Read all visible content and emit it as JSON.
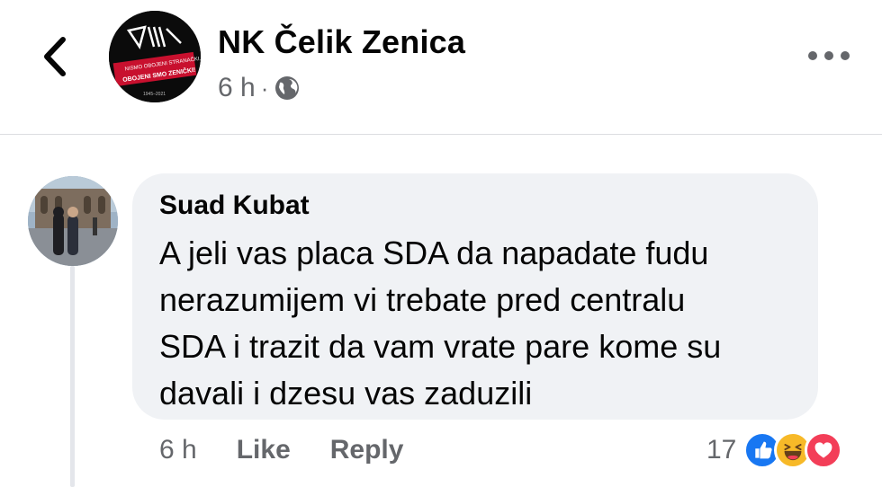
{
  "header": {
    "page_name": "NK Čelik Zenica",
    "time": "6 h",
    "separator": "·",
    "logo_text_1": "NISMO OBOJENI STRANAČKI,",
    "logo_text_2": "OBOJENI SMO ZENIČKI!",
    "logo_years": "1945–2021",
    "back_icon": "chevron-left-icon",
    "privacy_icon": "globe-icon",
    "more_icon": "more-horizontal-icon"
  },
  "comment": {
    "author": "Suad Kubat",
    "lines": [
      "A jeli vas placa SDA da napadate fudu",
      "nerazumijem vi trebate pred centralu",
      "SDA i trazit da vam vrate pare kome su",
      "davali i dzesu vas zaduzili"
    ],
    "time": "6 h",
    "like_label": "Like",
    "reply_label": "Reply",
    "reaction_count": "17",
    "reactions": [
      "like-reaction-icon",
      "haha-reaction-icon",
      "love-reaction-icon"
    ]
  },
  "colors": {
    "secondary_text": "#65676b",
    "bubble_bg": "#f0f2f5",
    "like_blue": "#1877f2",
    "love_red": "#f33e58",
    "haha_yellow": "#f7b928"
  }
}
